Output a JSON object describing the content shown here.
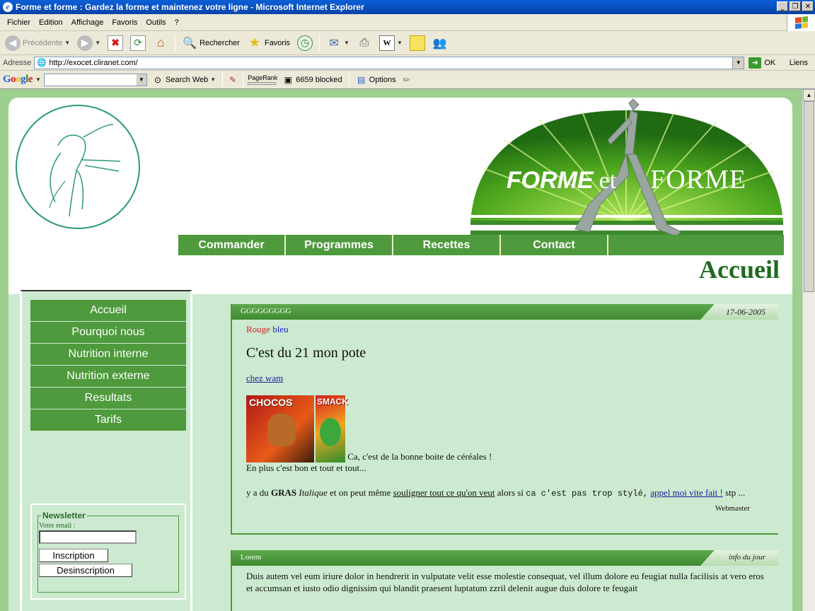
{
  "window": {
    "title": "Forme et forme : Gardez la forme et maintenez votre ligne - Microsoft Internet Explorer",
    "min": "_",
    "max": "❐",
    "close": "✕"
  },
  "menu": [
    "Fichier",
    "Edition",
    "Affichage",
    "Favoris",
    "Outils",
    "?"
  ],
  "toolbar": {
    "back": "Précédente",
    "search": "Rechercher",
    "favorites": "Favoris"
  },
  "address": {
    "label": "Adresse",
    "url": "http://exocet.cliranet.com/",
    "go": "OK",
    "links": "Liens"
  },
  "googlebar": {
    "logo": "Google",
    "search_web": "Search Web",
    "pagerank": "PageRank",
    "blocked": "6659 blocked",
    "options": "Options"
  },
  "banner": {
    "word1": "FORME",
    "word2": "et",
    "word3": "FORME"
  },
  "topnav": [
    "Commander",
    "Programmes",
    "Recettes",
    "Contact"
  ],
  "page_title": "Accueil",
  "sidenav": [
    "Accueil",
    "Pourquoi nous",
    "Nutrition interne",
    "Nutrition externe",
    "Resultats",
    "Tarifs"
  ],
  "newsletter": {
    "legend": "Newsletter",
    "email_label": "Votre email :",
    "subscribe": "Inscription",
    "unsubscribe": "Desinscription"
  },
  "article1": {
    "title": "GGGGGGGGG",
    "date": "17-06-2005",
    "red": "Rouge",
    "blue": "bleu",
    "heading": "C'est du 21 mon pote",
    "link": "chez wam",
    "img_label1": "CHOCOS",
    "img_label2": "SMACK",
    "caption": "Ca, c'est de la bonne boite de céréales !",
    "line2": "En plus c'est bon et tout et tout...",
    "p3_a": "y a du ",
    "p3_bold": "GRAS",
    "p3_italic": "Italique",
    "p3_b": " et on peut même ",
    "p3_underline": "souligner tout ce qu'on veut",
    "p3_c": " alors si ",
    "p3_mono": "ca c'est pas trop stylé,",
    "p3_link": "appel moi vite fait !",
    "p3_d": " stp ...",
    "author": "Webmaster"
  },
  "article2": {
    "title": "Lorem",
    "tag": "info du jour",
    "text": "Duis autem vel eum iriure dolor in hendrerit in vulputate velit esse molestie consequat, vel illum dolore eu feugiat nulla facilisis at vero eros et accumsan et iusto odio dignissim qui blandit praesent luptatum zzril delenit augue duis dolore te feugait"
  },
  "colors": {
    "nav_green": "#4e9a3c",
    "panel_bg": "#ccead0",
    "title_green": "#1f6b1f",
    "page_outer": "#9dd08f"
  }
}
